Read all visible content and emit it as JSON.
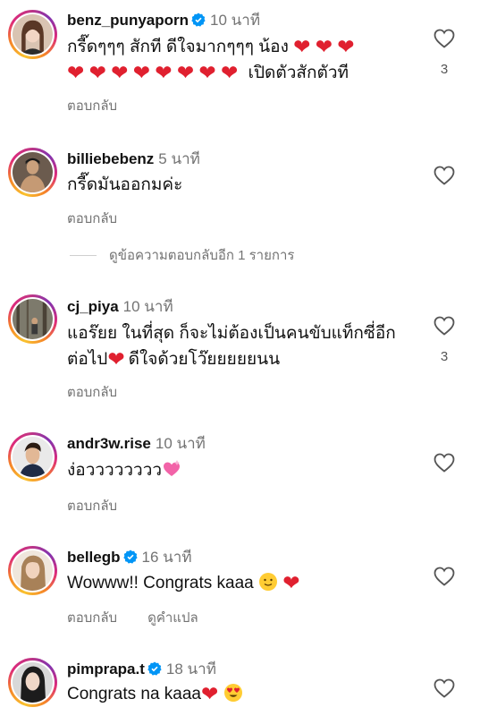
{
  "comments": [
    {
      "username": "benz_punyaporn",
      "verified": true,
      "time": "10 นาที",
      "text_line1": "กรี๊ดๆๆๆ  สักที  ดีใจมากๆๆๆ  น้อง",
      "text_line2": "เปิดตัวสักตัวที",
      "reply": "ตอบกลับ",
      "likes": "3",
      "heart_icon": "heart-emoji-icon"
    },
    {
      "username": "billiebebenz",
      "verified": false,
      "time": "5 นาที",
      "text": "กรี๊ดมันออกมค่ะ",
      "reply": "ตอบกลับ",
      "view_replies": "ดูข้อความตอบกลับอีก 1 รายการ"
    },
    {
      "username": "cj_piya",
      "verified": false,
      "time": "10 นาที",
      "text_line1": "แอร๊ยย ในที่สุด ก็จะไม่ต้องเป็นคนขับแท็กซี่อีก",
      "text_line2a": "ต่อไป",
      "text_line2b": "ดีใจด้วยโว๊ยยยยยนน",
      "reply": "ตอบกลับ",
      "likes": "3"
    },
    {
      "username": "andr3w.rise",
      "verified": false,
      "time": "10 นาที",
      "text": "ง่อวววววววว",
      "reply": "ตอบกลับ"
    },
    {
      "username": "bellegb",
      "verified": true,
      "time": "16 นาที",
      "text": "Wowww!! Congrats kaaa",
      "reply": "ตอบกลับ",
      "translate": "ดูคำแปล"
    },
    {
      "username": "pimprapa.t",
      "verified": true,
      "time": "18 นาที",
      "text": "Congrats na kaaa"
    }
  ],
  "colors": {
    "heart": "#e0202f",
    "verified": "#0095f6",
    "muted": "#737373"
  }
}
